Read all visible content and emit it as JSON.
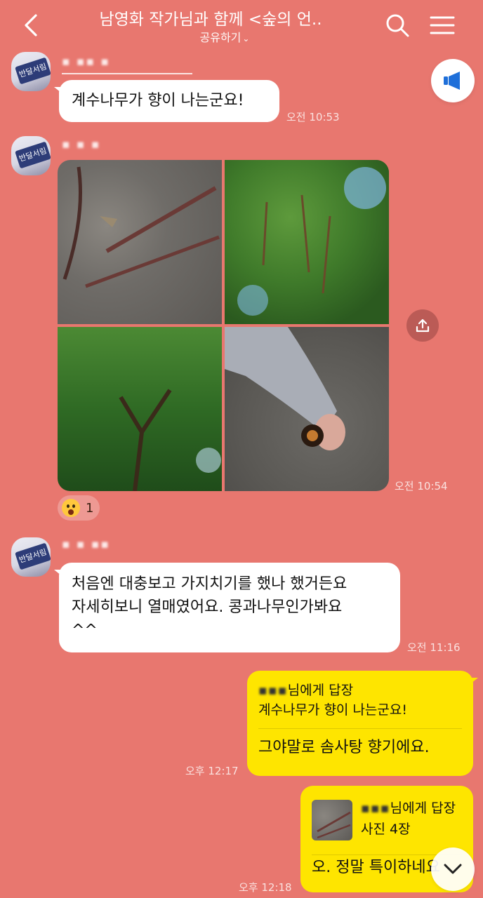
{
  "header": {
    "title": "남영화 작가님과 함께 <숲의 언..",
    "subtitle": "공유하기",
    "back_icon": "chevron-left-icon",
    "search_icon": "search-icon",
    "menu_icon": "hamburger-menu-icon"
  },
  "colors": {
    "background": "#E8776F",
    "my_bubble": "#FEE500",
    "other_bubble": "#FFFFFF",
    "notice_icon": "#1E6FD9"
  },
  "messages": [
    {
      "sender": "반달서림",
      "text": "계수나무가 향이 나는군요!",
      "time": "오전 10:53"
    },
    {
      "sender": "반달서림",
      "type": "photos",
      "photo_count": 4,
      "time": "오전 10:54",
      "reaction": {
        "emoji": "surprised-face-icon",
        "count": "1"
      }
    },
    {
      "sender": "반달서림",
      "lines": [
        "처음엔 대충보고 가지치기를 했나 했거든요",
        "자세히보니 열매였어요. 콩과나무인가봐요",
        "^^"
      ],
      "time": "오전 11:16"
    },
    {
      "reply_to": "님",
      "reply_suffix": "에게 답장",
      "quote": "계수나무가 향이 나는군요!",
      "text": "그야말로 솜사탕 향기에요.",
      "time": "오후 12:17"
    },
    {
      "reply_to": "님",
      "reply_suffix": "에게 답장",
      "quote": "사진 4장",
      "text": "오. 정말 특이하네요",
      "time": "오후 12:18"
    }
  ]
}
